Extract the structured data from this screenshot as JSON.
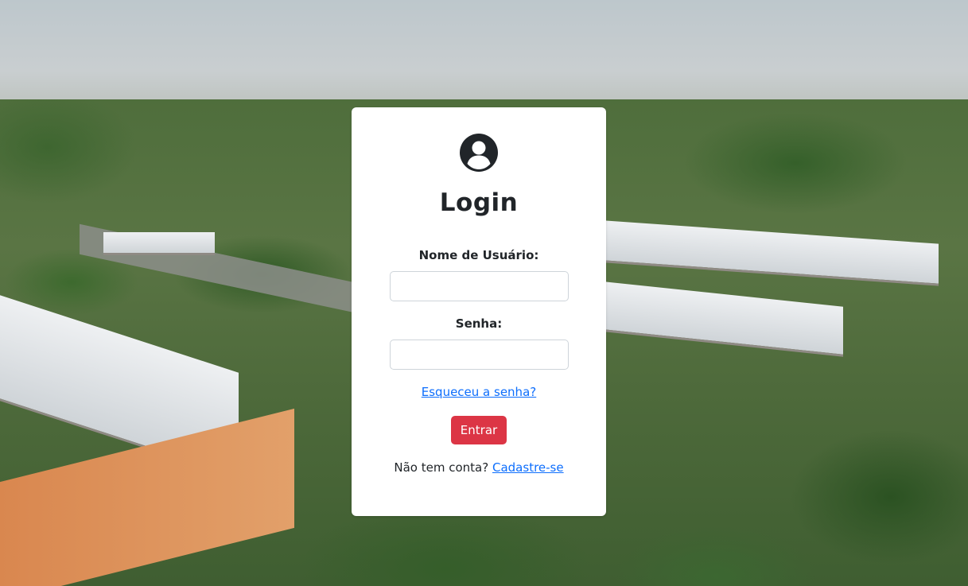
{
  "login": {
    "title": "Login",
    "username_label": "Nome de Usuário:",
    "username_value": "",
    "password_label": "Senha:",
    "password_value": "",
    "forgot_link": "Esqueceu a senha?",
    "submit_label": "Entrar",
    "signup_prompt": "Não tem conta?",
    "signup_link": "Cadastre-se",
    "avatar_icon": "user-circle-icon"
  },
  "colors": {
    "primary_button": "#dc3545",
    "link": "#0d6efd",
    "card_background": "#ffffff",
    "text": "#212529"
  }
}
